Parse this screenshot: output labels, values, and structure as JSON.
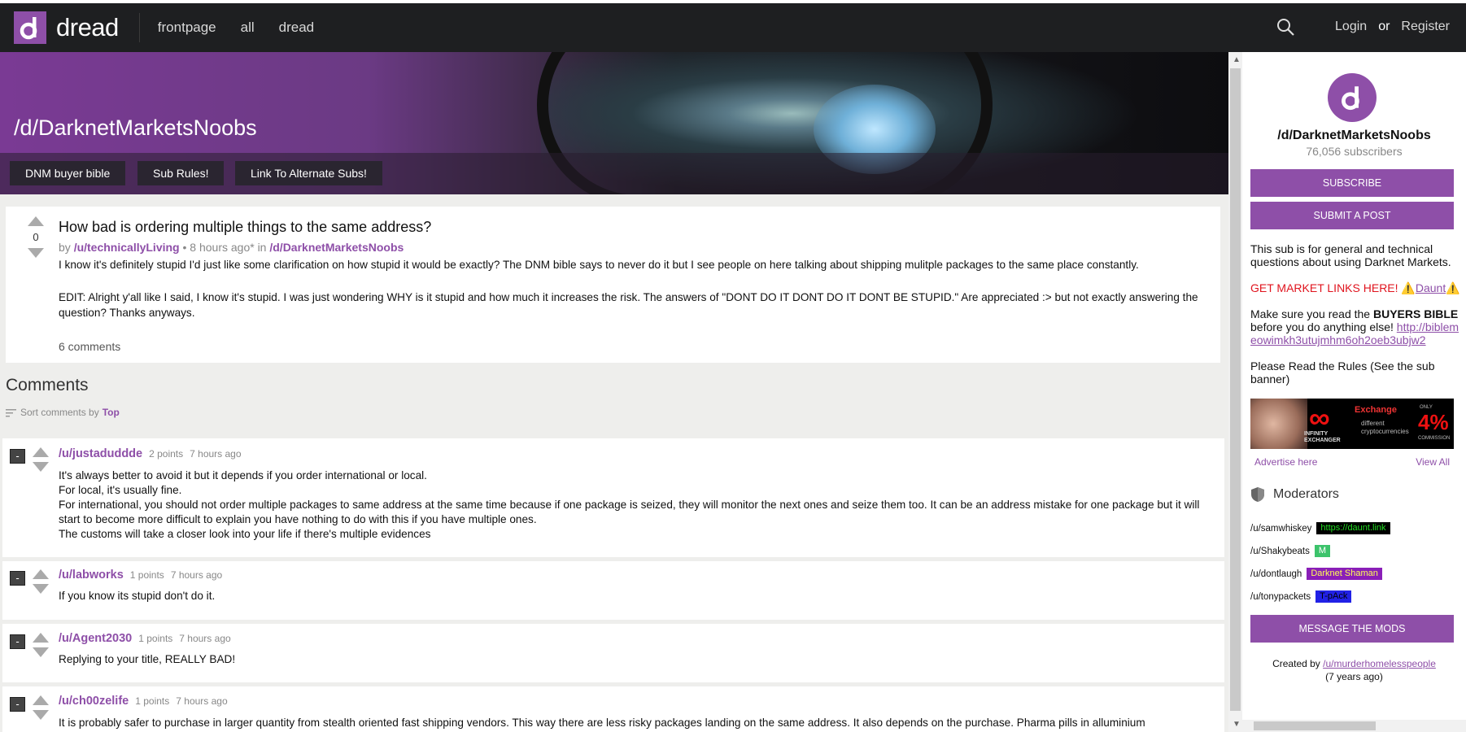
{
  "topbar": {
    "logo_letter": "d",
    "site_name": "dread",
    "nav": [
      "frontpage",
      "all",
      "dread"
    ],
    "login": "Login",
    "or": "or",
    "register": "Register"
  },
  "banner": {
    "title": "/d/DarknetMarketsNoobs",
    "buttons": [
      "DNM buyer bible",
      "Sub Rules!",
      "Link To Alternate Subs!"
    ]
  },
  "post": {
    "score": "0",
    "title": "How bad is ordering multiple things to the same address?",
    "by": "by",
    "author": "/u/technicallyLiving",
    "time": " • 8 hours ago* in ",
    "sub": "/d/DarknetMarketsNoobs",
    "body_1": "I know it's definitely stupid I'd just like some clarification on how stupid it would be exactly? The DNM bible says to never do it but I see people on here talking about shipping mulitple packages to the same place constantly.",
    "body_2": "EDIT: Alright y'all like I said, I know it's stupid. I was just wondering WHY is it stupid and how much it increases the risk. The answers of \"DONT DO IT DONT DO IT DONT BE STUPID.\" Are appreciated :> but not exactly answering the question? Thanks anyways.",
    "comments_count": "6 comments"
  },
  "comments_section": {
    "heading": "Comments",
    "sort_label": "Sort comments by",
    "sort_value": "Top"
  },
  "comments": [
    {
      "user": "/u/justaduddde",
      "points": "2 points",
      "time": "7 hours ago",
      "lines": [
        "It's always better to avoid it but it depends if you order international or local.",
        "For local, it's usually fine.",
        "For international, you should not order multiple packages to same address at the same time because if one package is seized, they will monitor the next ones and seize them too. It can be an address mistake for one package but it will start to become more difficult to explain you have nothing to do with this if you have multiple ones.",
        "The customs will take a closer look into your life if there's multiple evidences"
      ]
    },
    {
      "user": "/u/labworks",
      "points": "1 points",
      "time": "7 hours ago",
      "lines": [
        "If you know its stupid don't do it."
      ]
    },
    {
      "user": "/u/Agent2030",
      "points": "1 points",
      "time": "7 hours ago",
      "lines": [
        "Replying to your title, REALLY BAD!"
      ]
    },
    {
      "user": "/u/ch00zelife",
      "points": "1 points",
      "time": "7 hours ago",
      "lines": [
        "It is probably safer to purchase in larger quantity from stealth oriented fast shipping vendors. This way there are less risky packages landing on the same address. It also depends on the purchase. Pharma pills in alluminium"
      ]
    }
  ],
  "collapse_label": "-",
  "sidebar": {
    "avatar_letter": "d",
    "title": "/d/DarknetMarketsNoobs",
    "subscribers": "76,056 subscribers",
    "subscribe": "SUBSCRIBE",
    "submit": "SUBMIT A POST",
    "desc": "This sub is for general and technical questions about using Darknet Markets.",
    "market_links": "GET MARKET LINKS HERE! ⚠️",
    "daunt": "Daunt",
    "daunt_warn": "⚠️",
    "bible_pre": "Make sure you read the ",
    "bible_bold": "BUYERS BIBLE",
    "bible_post": " before you do anything else! ",
    "bible_link": "http://biblemeowimkh3utujmhm6oh2oeb3ubjw2",
    "rules": "Please Read the Rules (See the sub banner)",
    "ad": {
      "exchange": "Exchange",
      "desc": "different cryptocurrencies",
      "only": "ONLY",
      "percent": "4%",
      "commission": "COMMISSION",
      "brand": "INFINITY EXCHANGER"
    },
    "advertise": "Advertise here",
    "view_all": "View All",
    "moderators_heading": "Moderators",
    "mods": [
      {
        "name": "/u/samwhiskey",
        "flair": "https://daunt.link",
        "flair_bg": "#000000",
        "flair_fg": "#22dd22"
      },
      {
        "name": "/u/Shakybeats",
        "flair": "M",
        "flair_bg": "#3cc36b",
        "flair_fg": "#ffffff"
      },
      {
        "name": "/u/dontlaugh",
        "flair": "Darknet Shaman",
        "flair_bg": "#8a1fb8",
        "flair_fg": "#ffff55"
      },
      {
        "name": "/u/tonypackets",
        "flair": "T-pAck",
        "flair_bg": "#2121e6",
        "flair_fg": "#000000"
      }
    ],
    "message_mods": "MESSAGE THE MODS",
    "created_by": "Created by ",
    "creator": "/u/murderhomelesspeople",
    "created_ago": "(7 years ago)"
  },
  "colors": {
    "accent": "#8e4fa8",
    "topbar": "#1e1f21",
    "background": "#eeeeec"
  }
}
